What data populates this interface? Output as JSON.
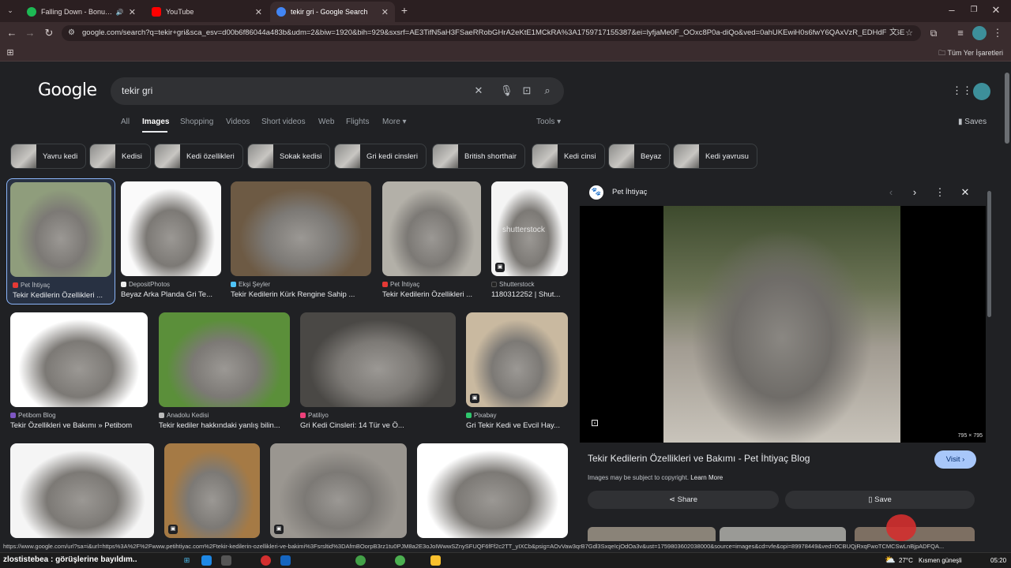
{
  "tabs": [
    {
      "title": "Falling Down - Bonus Track",
      "fav_color": "#1db954",
      "audio": "🔊"
    },
    {
      "title": "YouTube",
      "fav_color": "#ff0000"
    },
    {
      "title": "tekir gri - Google Search",
      "fav_color": "#4285f4"
    }
  ],
  "tab_close": "✕",
  "new_tab": "+",
  "url": "google.com/search?q=tekir+gri&sca_esv=d00b6f86044a483b&udm=2&biw=1920&bih=929&sxsrf=AE3TifN5aH3FSaeRRobGHrA2eKtE1MCkRA%3A1759717155387&ei=lyfjaMe0F_OOxc8P0a-diQo&ved=0ahUKEwiH0s6fwY6QAxVzR_EDHdFXJ6E...",
  "bookmarks_all": "Tüm Yer İşaretleri",
  "google": {
    "logo": "Google",
    "query": "tekir gri",
    "saves": "Saves"
  },
  "nav": [
    "All",
    "Images",
    "Shopping",
    "Videos",
    "Short videos",
    "Web",
    "Flights",
    "More ▾"
  ],
  "tools": "Tools ▾",
  "chips": [
    "Yavru kedi",
    "Kedisi",
    "Kedi özellikleri",
    "Sokak kedisi",
    "Gri kedi cinsleri",
    "British shorthair",
    "Kedi cinsi",
    "Beyaz",
    "Kedi yavrusu"
  ],
  "results": [
    {
      "source": "Pet İhtiyaç",
      "title": "Tekir Kedilerin Özellikleri ...",
      "src_color": "#e53935"
    },
    {
      "source": "DepositPhotos",
      "title": "Beyaz Arka Planda Gri Te...",
      "src_color": "#eeeeee"
    },
    {
      "source": "Ekşi Şeyler",
      "title": "Tekir Kedilerin Kürk Rengine Sahip ...",
      "src_color": "#4fc3f7"
    },
    {
      "source": "Pet İhtiyaç",
      "title": "Tekir Kedilerin Özellikleri ...",
      "src_color": "#e53935"
    },
    {
      "source": "Shutterstock",
      "title": "1180312252 | Shut...",
      "src_color": "#222222"
    },
    {
      "source": "Petibom Blog",
      "title": "Tekir Özellikleri ve Bakımı » Petibom",
      "src_color": "#7e57c2"
    },
    {
      "source": "Anadolu Kedisi",
      "title": "Tekir kediler hakkındaki yanlış bilin...",
      "src_color": "#bbbbbb"
    },
    {
      "source": "Patiliyo",
      "title": "Gri Kedi Cinsleri: 14 Tür ve Ö...",
      "src_color": "#ec407a"
    },
    {
      "source": "Pixabay",
      "title": "Gri Tekir Kedi ve Evcil Hay...",
      "src_color": "#2ec66d"
    }
  ],
  "watermark": "shutterstock",
  "panel": {
    "source": "Pet İhtiyaç",
    "dims": "795 × 795",
    "title": "Tekir Kedilerin Özellikleri ve Bakımı - Pet İhtiyaç Blog",
    "visit": "Visit ›",
    "copyright": "Images may be subject to copyright.",
    "learn_more": "Learn More",
    "share": "Share",
    "save": "Save"
  },
  "status_url": "https://www.google.com/url?sa=i&url=https%3A%2F%2Fwww.petihtiyac.com%2Ftekir-kedilerin-ozellikleri-ve-bakimi%3Fsrsltid%3DAfmBOorpB3rz1tu0PJM8a2E3oJoIWwwSZnySFUQF6fFf2c2TT_yIXCb&psig=AOvVaw3qrB7Gdl3SxqeIcjOdOa3v&ust=1759803602038000&source=images&cd=vfe&opi=89978449&ved=0CBUQjRxqFwoTCMCSwLnBjpADFQA...",
  "ticker": "zlostistebea : görüşlerine bayıldım..",
  "taskbar": {
    "weather": "27°C",
    "weather_text": "Kısmen güneşli",
    "time": "05:20"
  },
  "colors": {
    "accent": "#8ab4f8",
    "visit_bg": "#a8c7fa",
    "visit_fg": "#062e6f",
    "button_bg": "#303134",
    "page_bg": "#202124",
    "tab_bg": "#2b1f21"
  }
}
